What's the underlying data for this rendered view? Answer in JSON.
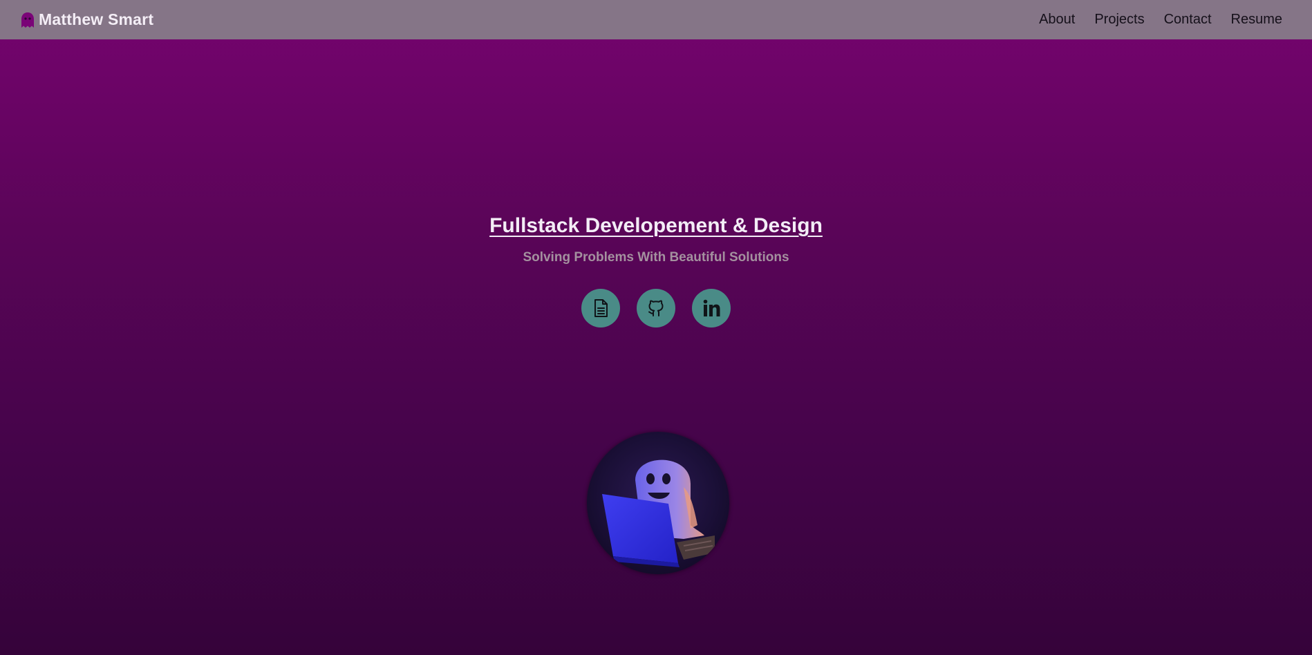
{
  "navbar": {
    "brand_icon": "ghost-icon",
    "brand_name": "Matthew Smart",
    "links": [
      {
        "label": "About"
      },
      {
        "label": "Projects"
      },
      {
        "label": "Contact"
      },
      {
        "label": "Resume"
      }
    ]
  },
  "hero": {
    "title": "Fullstack Developement & Design",
    "subtitle": "Solving Problems With Beautiful Solutions",
    "social_icons": [
      "document-icon",
      "github-icon",
      "linkedin-icon"
    ]
  },
  "avatar": {
    "image": "ghost-with-laptop-illustration"
  },
  "colors": {
    "navbar_bg": "#857587",
    "background_top": "#76036f",
    "background_bottom": "#35033a",
    "social_button": "#4a8b87",
    "brand_icon": "#76036f"
  }
}
